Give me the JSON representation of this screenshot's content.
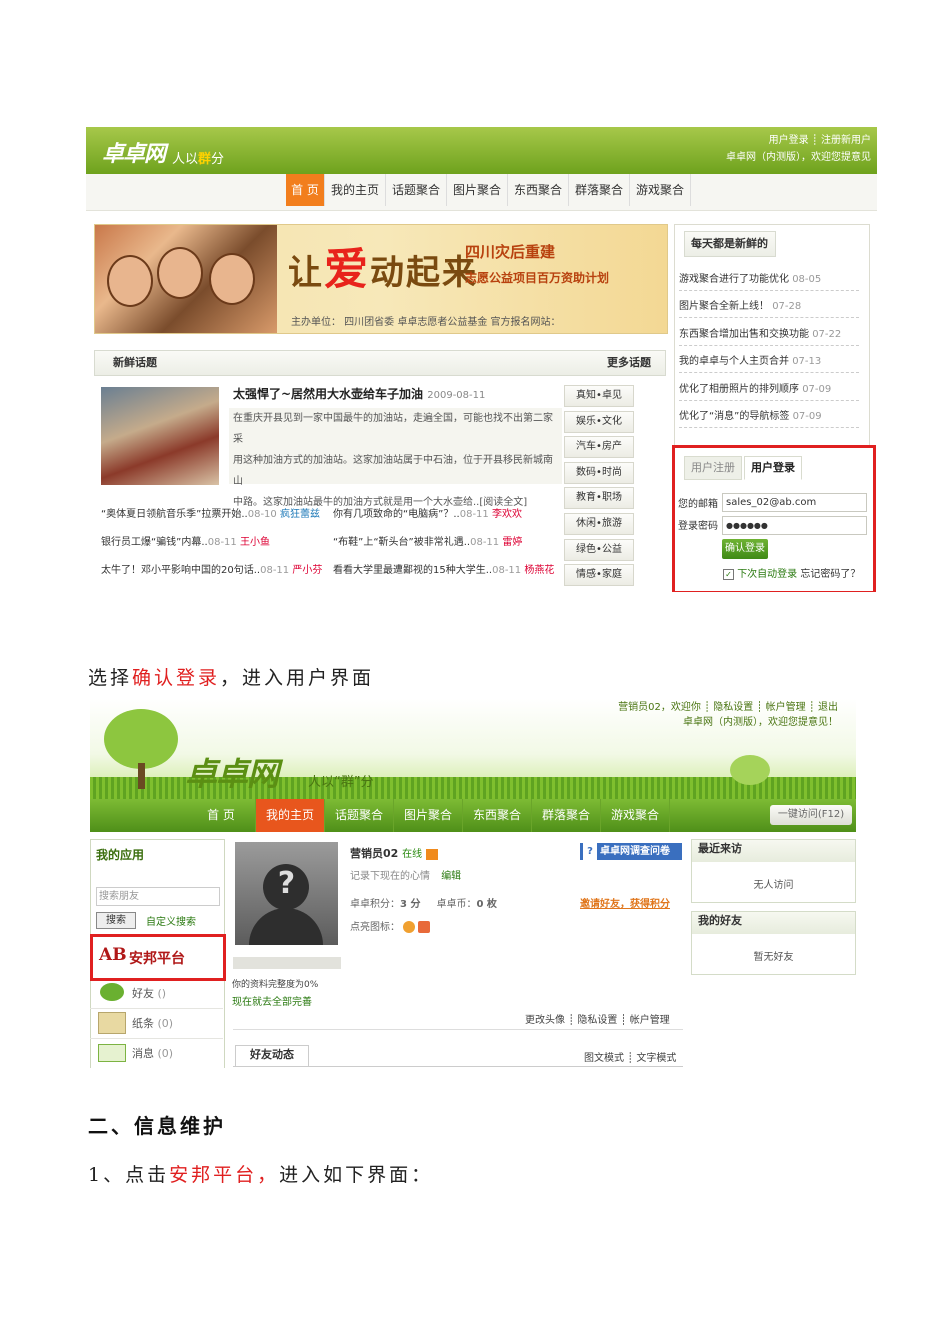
{
  "shot1": {
    "logo": "卓卓网",
    "slogan_prefix": "人以",
    "slogan_em": "群",
    "slogan_suffix": "分",
    "top_links": "用户登录 ┊ 注册新用户",
    "top_notice": "卓卓网（内测版），欢迎您提意见",
    "nav": [
      "首 页",
      "我的主页",
      "话题聚合",
      "图片聚合",
      "东西聚合",
      "群落聚合",
      "游戏聚合"
    ],
    "banner": {
      "slogan_a": "让",
      "slogan_b": "爱",
      "slogan_c": "动起来",
      "line1": "四川灾后重建",
      "line2": "志愿公益项目百万资助计划",
      "sponsor": "主办单位：          四川团省委      卓卓志愿者公益基金    官方报名网站："
    },
    "fresh_topics": {
      "title": "新鲜话题",
      "more": "更多话题",
      "headline": "太强悍了~居然用大水壶给车子加油",
      "headline_date": "2009-08-11",
      "summary": [
        "在重庆开县见到一家中国最牛的加油站，走遍全国，可能也找不出第二家采",
        "用这种加油方式的加油站。这家加油站属于中石油，位于开县移民新城南山",
        "中路。这家加油站最牛的加油方式就是用一个大水壶给..[阅读全文]"
      ],
      "list": [
        {
          "text": "“奥体夏日领航音乐季”拉票开始..",
          "date": "08-10",
          "user": "疯狂蕾兹"
        },
        {
          "text": "你有几项致命的“电脑病”？..",
          "date": "08-11",
          "user": "李欢欢"
        },
        {
          "text": "银行员工爆“骗钱”内幕..",
          "date": "08-11",
          "user": "王小鱼"
        },
        {
          "text": "“布鞋”上“靳头台”被非常礼遇..",
          "date": "08-11",
          "user": "雷婷"
        },
        {
          "text": "太牛了！邓小平影响中国的20句话..",
          "date": "08-11",
          "user": "严小芬"
        },
        {
          "text": "看看大学里最遭鄙视的15种大学生..",
          "date": "08-11",
          "user": "杨燕花"
        }
      ],
      "categories": [
        "真知•卓见",
        "娱乐•文化",
        "汽车•房产",
        "数码•时尚",
        "教育•职场",
        "休闲•旅游",
        "绿色•公益",
        "情感•家庭"
      ]
    },
    "daily_new": {
      "title": "每天都是新鲜的",
      "items": [
        {
          "text": "游戏聚合进行了功能优化",
          "date": "08-05"
        },
        {
          "text": "图片聚合全新上线！",
          "date": "07-28"
        },
        {
          "text": "东西聚合增加出售和交换功能",
          "date": "07-22"
        },
        {
          "text": "我的卓卓与个人主页合并",
          "date": "07-13"
        },
        {
          "text": "优化了相册照片的排列顺序",
          "date": "07-09"
        },
        {
          "text": "优化了“消息”的导航标签",
          "date": "07-09"
        }
      ]
    },
    "login": {
      "tab_register": "用户注册",
      "tab_login": "用户登录",
      "email_label": "您的邮箱",
      "password_label": "登录密码",
      "email_value": "sales_02@ab.com",
      "password_value": "●●●●●●",
      "submit": "确认登录",
      "remember": "下次自动登录",
      "forgot": "忘记密码了？"
    }
  },
  "text1": {
    "a": "选择",
    "b": "确认登录",
    "c": "，进入用户界面"
  },
  "shot2": {
    "logo": "卓卓网",
    "slogan": "人以“群”分",
    "links": "营销员02，欢迎你  ┊  隐私设置  ┊  帐户管理  ┊  退出",
    "notice": "卓卓网（内测版），欢迎您提意见！",
    "nav": [
      "首 页",
      "我的主页",
      "话题聚合",
      "图片聚合",
      "东西聚合",
      "群落聚合",
      "游戏聚合"
    ],
    "one_key": "一键访问(F12)",
    "my_apps": "我的应用",
    "search_placeholder": "搜索朋友",
    "search_btn": "搜索",
    "custom_search": "自定义搜索",
    "anbang": "安邦平台",
    "anbang_badge": "AB",
    "side_items": [
      {
        "label": "好友",
        "count": "()"
      },
      {
        "label": "纸条",
        "count": "(0)"
      },
      {
        "label": "消息",
        "count": "(0)"
      }
    ],
    "profile": {
      "name": "营销员02",
      "status": "在线",
      "mood": "记录下现在的心情",
      "edit": "编辑",
      "score_label": "卓卓积分：",
      "score": "3 分",
      "coin_label": "卓卓币：",
      "coin": "0 枚",
      "icons_label": "点亮图标：",
      "survey": "卓卓网调查问卷",
      "invite": "邀请好友，获得积分",
      "completeness": "你的资料完整度为0%",
      "complete_link": "现在就去全部完善",
      "actions": "更改头像 ┊ 隐私设置 ┊ 帐户管理",
      "feed_tab": "好友动态",
      "modes": "图文模式 ┊ 文字模式"
    },
    "recent": {
      "title": "最近来访",
      "empty": "无人访问"
    },
    "friends": {
      "title": "我的好友",
      "empty": "暂无好友"
    }
  },
  "section2": "二、信息维护",
  "step1": {
    "a": "1、点击",
    "b": "安邦平台，",
    "c": "进入如下界面："
  }
}
